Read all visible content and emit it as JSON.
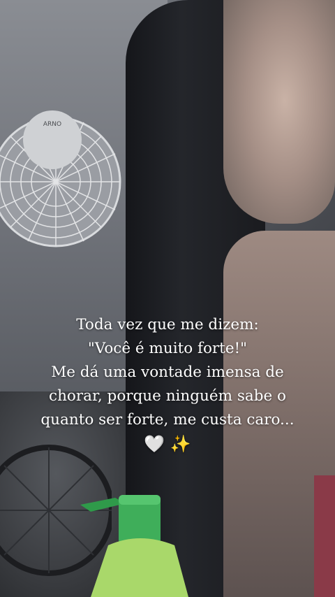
{
  "caption": {
    "line1": "Toda vez que me dizem:",
    "line2": "\"Você é muito forte!\"",
    "line3": "Me dá uma vontade imensa de",
    "line4": "chorar, porque ninguém sabe o",
    "line5": "quanto ser forte, me custa caro...",
    "heart_emoji": "🤍",
    "sparkles_emoji": "✨"
  },
  "photo": {
    "fan_brand": "ARNO"
  },
  "colors": {
    "caption_text": "#ffffff",
    "heart": "#f4f4f4",
    "sparkles": "#f3c734",
    "bottle_cap": "#3fae5a",
    "bottle_body": "#a9d86a"
  }
}
